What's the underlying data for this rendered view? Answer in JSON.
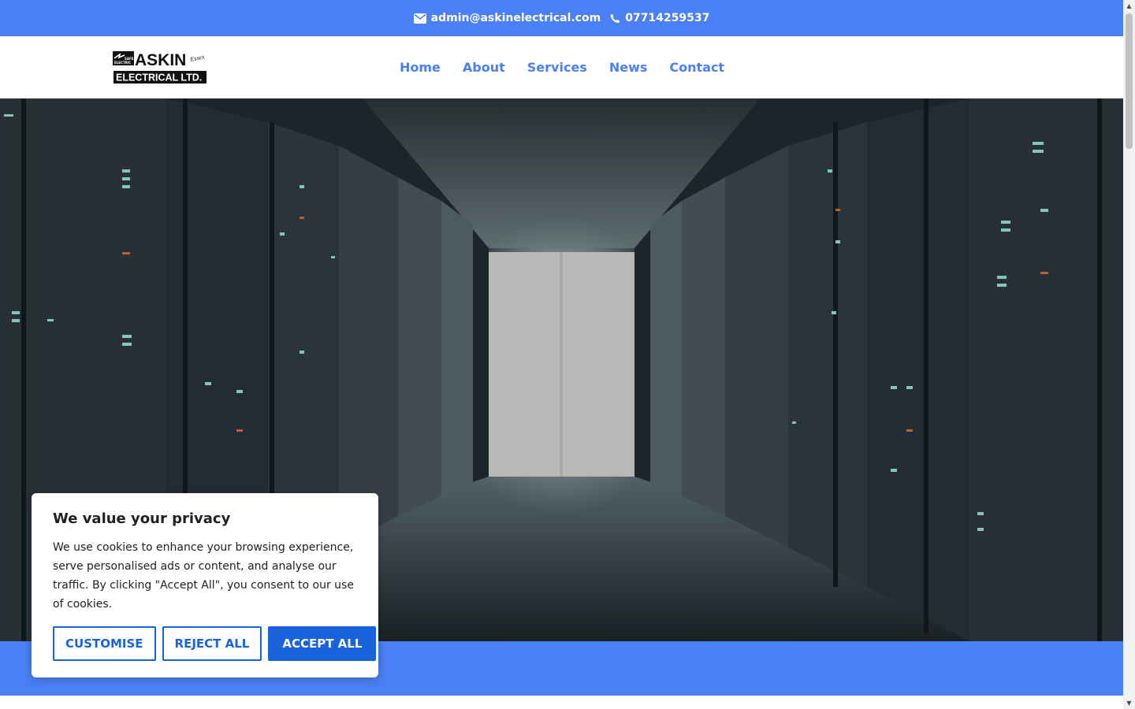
{
  "topbar": {
    "email": "admin@askinelectrical.com",
    "phone": "07714259537",
    "email_icon": "envelope-icon",
    "phone_icon": "phone-icon"
  },
  "logo": {
    "line1": "ASKIN",
    "line2": "ELECTRICAL LTD.",
    "badge_top": "SAFE",
    "badge_bottom": "ELECTRIC",
    "script": "Essex"
  },
  "nav": {
    "items": [
      {
        "label": "Home"
      },
      {
        "label": "About"
      },
      {
        "label": "Services"
      },
      {
        "label": "News"
      },
      {
        "label": "Contact"
      }
    ]
  },
  "cookie": {
    "title": "We value your privacy",
    "body": "We use cookies to enhance your browsing experience, serve personalised ads or content, and analyse our traffic. By clicking \"Accept All\", you consent to our use of cookies.",
    "customise_label": "CUSTOMISE",
    "reject_label": "REJECT ALL",
    "accept_label": "ACCEPT ALL"
  },
  "colors": {
    "brand_blue": "#4a7ff5",
    "button_blue": "#1863dc"
  }
}
